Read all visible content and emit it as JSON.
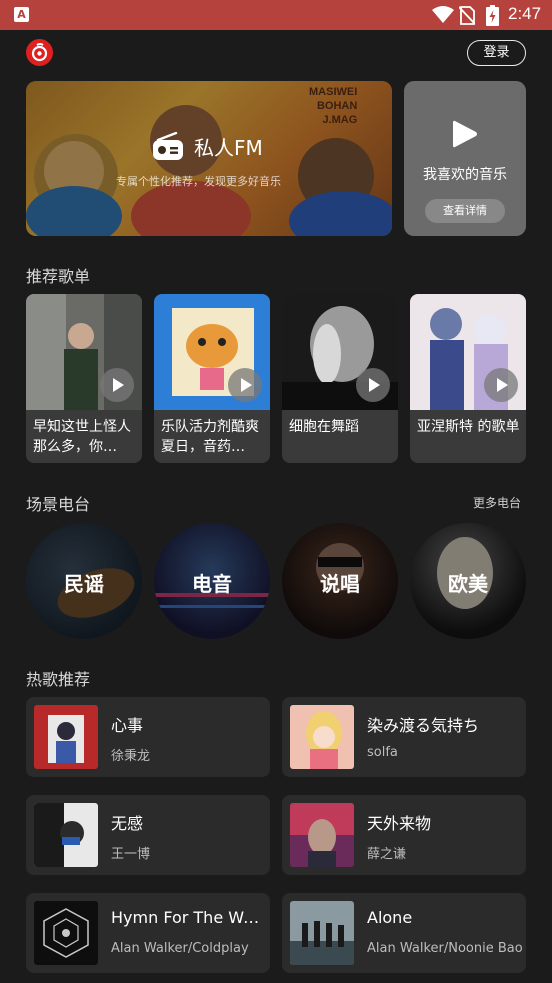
{
  "status_bar": {
    "time": "2:47",
    "app_glyph": "A",
    "colors": {
      "background": "#b5423c"
    },
    "icons": [
      "wifi-icon",
      "no-sim-icon",
      "battery-charging-icon"
    ]
  },
  "header": {
    "logo_icon": "netease-music-logo-icon",
    "login_label": "登录"
  },
  "fm_banner": {
    "title": "私人FM",
    "subtitle": "专属个性化推荐，发现更多好音乐",
    "art_text": "MASIWEI\nBOHAN\nJ.MAG"
  },
  "favorite_card": {
    "title": "我喜欢的音乐",
    "button_label": "查看详情"
  },
  "recommended": {
    "section_title": "推荐歌单",
    "playlists": [
      {
        "name": "早知这世上怪人那么多，你…"
      },
      {
        "name": "乐队活力剂酷爽夏日，音药…"
      },
      {
        "name": "细胞在舞蹈"
      },
      {
        "name": "亚涅斯特 的歌单"
      }
    ]
  },
  "radio": {
    "section_title": "场景电台",
    "more_label": "更多电台",
    "stations": [
      {
        "label": "民谣"
      },
      {
        "label": "电音"
      },
      {
        "label": "说唱"
      },
      {
        "label": "欧美"
      }
    ]
  },
  "hot_songs": {
    "section_title": "热歌推荐",
    "songs": [
      {
        "title": "心事",
        "artist": "徐秉龙"
      },
      {
        "title": "染み渡る気持ち",
        "artist": "solfa"
      },
      {
        "title": "无感",
        "artist": "王一博"
      },
      {
        "title": "天外来物",
        "artist": "薛之谦"
      },
      {
        "title": "Hymn For The Weekend",
        "artist": "Alan Walker/Coldplay"
      },
      {
        "title": "Alone",
        "artist": "Alan Walker/Noonie Bao"
      }
    ]
  },
  "colors": {
    "background": "#1b1b1b",
    "card": "#2b2b2b",
    "brand_red": "#e0201f"
  }
}
